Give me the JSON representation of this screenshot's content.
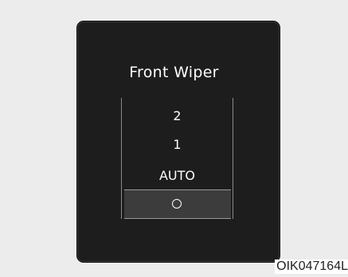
{
  "display": {
    "title": "Front Wiper",
    "options": [
      {
        "label": "2",
        "selected": false
      },
      {
        "label": "1",
        "selected": false
      },
      {
        "label": "AUTO",
        "selected": false
      },
      {
        "icon": "off-circle-icon",
        "selected": true
      }
    ]
  },
  "image_code": "OIK047164L",
  "colors": {
    "display_bg": "#1d1d1d",
    "selected_bg": "#3c3c3c",
    "text": "#ffffff"
  }
}
